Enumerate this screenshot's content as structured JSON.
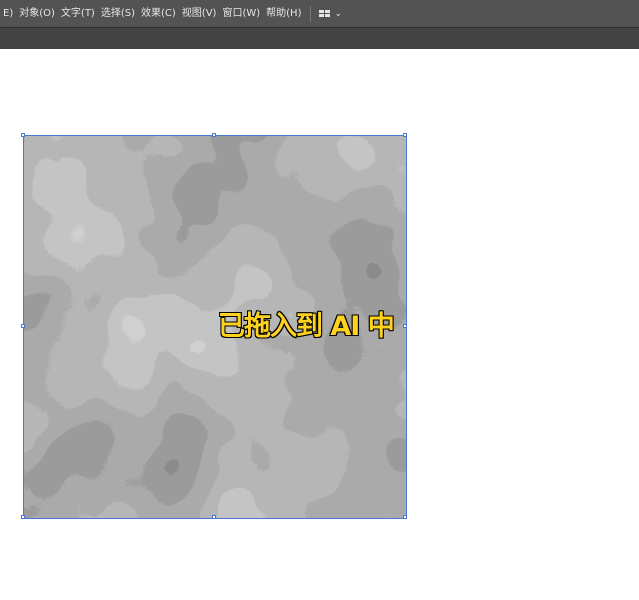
{
  "menubar": {
    "items": [
      "E)",
      "对象(O)",
      "文字(T)",
      "选择(S)",
      "效果(C)",
      "视图(V)",
      "窗口(W)",
      "帮助(H)"
    ],
    "workspace_chevron": "⌄"
  },
  "overlay": {
    "caption": "已拖入到 AI 中",
    "caption_color": "#ffd21f"
  },
  "selection": {
    "color": "#4a78d6"
  }
}
